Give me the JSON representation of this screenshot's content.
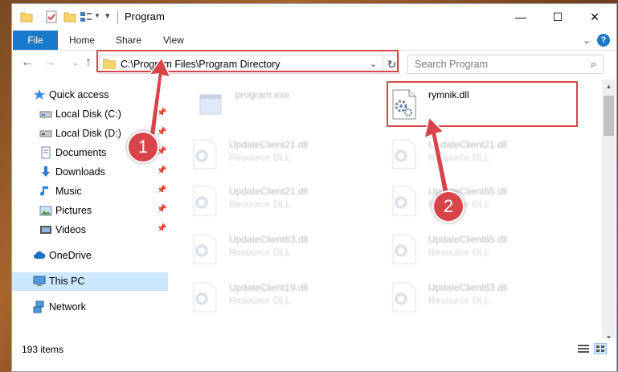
{
  "window": {
    "title": "Program"
  },
  "ribbon": {
    "file": "File",
    "home": "Home",
    "share": "Share",
    "view": "View",
    "help": "?"
  },
  "address": {
    "path": "C:\\Program Files\\Program Directory"
  },
  "search": {
    "placeholder": "Search Program"
  },
  "sidebar": {
    "items": [
      {
        "label": "Quick access",
        "icon": "star-icon"
      },
      {
        "label": "Local Disk (C:)",
        "icon": "drive-icon"
      },
      {
        "label": "Local Disk (D:)",
        "icon": "drive-icon"
      },
      {
        "label": "Documents",
        "icon": "documents-icon"
      },
      {
        "label": "Downloads",
        "icon": "downloads-icon"
      },
      {
        "label": "Music",
        "icon": "music-icon"
      },
      {
        "label": "Pictures",
        "icon": "pictures-icon"
      },
      {
        "label": "Videos",
        "icon": "videos-icon"
      },
      {
        "label": "OneDrive",
        "icon": "cloud-icon"
      },
      {
        "label": "This PC",
        "icon": "computer-icon"
      },
      {
        "label": "Network",
        "icon": "network-icon"
      }
    ]
  },
  "files": {
    "highlighted": {
      "name": "rymnik.dll"
    },
    "list": [
      {
        "name": "program.exe",
        "type": ""
      },
      {
        "name": "UpdateClient21.dll",
        "type": "Resource DLL"
      },
      {
        "name": "UpdateClient21.dll",
        "type": "Resource DLL"
      },
      {
        "name": "UpdateClient21.dll",
        "type": "Resource DLL"
      },
      {
        "name": "UpdateClient65.dll",
        "type": "Resource DLL"
      },
      {
        "name": "UpdateClient63.dll",
        "type": "Resource DLL"
      },
      {
        "name": "UpdateClient65.dll",
        "type": "Resource DLL"
      },
      {
        "name": "UpdateClient19.dll",
        "type": "Resource DLL"
      },
      {
        "name": "UpdateClient63.dll",
        "type": "Resource DLL"
      }
    ]
  },
  "status": {
    "count": "193 items"
  },
  "annotations": {
    "badge1": "1",
    "badge2": "2",
    "color": "#d9434a"
  }
}
